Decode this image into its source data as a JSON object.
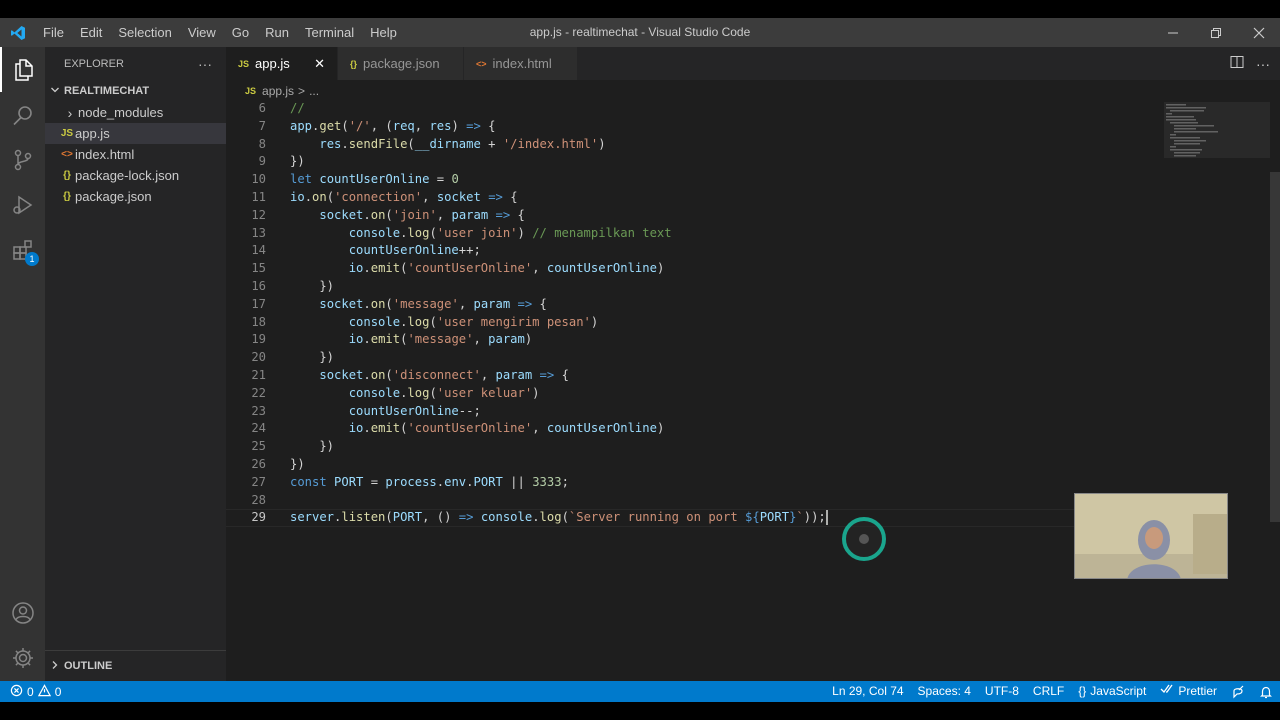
{
  "window": {
    "title": "app.js - realtimechat - Visual Studio Code"
  },
  "menu": [
    "File",
    "Edit",
    "Selection",
    "View",
    "Go",
    "Run",
    "Terminal",
    "Help"
  ],
  "activitybar": {
    "extensions_badge": "1"
  },
  "sidebar": {
    "header": "EXPLORER",
    "more": "···",
    "folder": "REALTIMECHAT",
    "items": [
      {
        "icon": "›",
        "label": "node_modules"
      },
      {
        "icon": "JS",
        "label": "app.js"
      },
      {
        "icon": "<>",
        "label": "index.html"
      },
      {
        "icon": "{}",
        "label": "package-lock.json"
      },
      {
        "icon": "{}",
        "label": "package.json"
      }
    ],
    "outline": "OUTLINE"
  },
  "tabs": [
    {
      "icon": "JS",
      "label": "app.js",
      "close": "✕"
    },
    {
      "icon": "{}",
      "label": "package.json"
    },
    {
      "icon": "<>",
      "label": "index.html"
    }
  ],
  "breadcrumb": {
    "icon": "JS",
    "file": "app.js",
    "sep": ">",
    "rest": "..."
  },
  "code": {
    "line_numbers": [
      "6",
      "7",
      "8",
      "9",
      "10",
      "11",
      "12",
      "13",
      "14",
      "15",
      "16",
      "17",
      "18",
      "19",
      "20",
      "21",
      "22",
      "23",
      "24",
      "25",
      "26",
      "27",
      "28",
      "29"
    ],
    "lines": [
      [
        {
          "c": "cm",
          "t": "//"
        }
      ],
      [
        {
          "c": "var",
          "t": "app"
        },
        {
          "c": "pl",
          "t": "."
        },
        {
          "c": "fn",
          "t": "get"
        },
        {
          "c": "pl",
          "t": "("
        },
        {
          "c": "str",
          "t": "'/'"
        },
        {
          "c": "pl",
          "t": ", ("
        },
        {
          "c": "var",
          "t": "req"
        },
        {
          "c": "pl",
          "t": ", "
        },
        {
          "c": "var",
          "t": "res"
        },
        {
          "c": "pl",
          "t": ") "
        },
        {
          "c": "kw",
          "t": "=>"
        },
        {
          "c": "pl",
          "t": " {"
        }
      ],
      [
        {
          "c": "pl",
          "t": "    "
        },
        {
          "c": "var",
          "t": "res"
        },
        {
          "c": "pl",
          "t": "."
        },
        {
          "c": "fn",
          "t": "sendFile"
        },
        {
          "c": "pl",
          "t": "("
        },
        {
          "c": "var",
          "t": "__dirname"
        },
        {
          "c": "pl",
          "t": " + "
        },
        {
          "c": "str",
          "t": "'/index.html'"
        },
        {
          "c": "pl",
          "t": ")"
        }
      ],
      [
        {
          "c": "pl",
          "t": "})"
        }
      ],
      [
        {
          "c": "kw",
          "t": "let"
        },
        {
          "c": "pl",
          "t": " "
        },
        {
          "c": "var",
          "t": "countUserOnline"
        },
        {
          "c": "pl",
          "t": " = "
        },
        {
          "c": "num",
          "t": "0"
        }
      ],
      [
        {
          "c": "var",
          "t": "io"
        },
        {
          "c": "pl",
          "t": "."
        },
        {
          "c": "fn",
          "t": "on"
        },
        {
          "c": "pl",
          "t": "("
        },
        {
          "c": "str",
          "t": "'connection'"
        },
        {
          "c": "pl",
          "t": ", "
        },
        {
          "c": "var",
          "t": "socket"
        },
        {
          "c": "pl",
          "t": " "
        },
        {
          "c": "kw",
          "t": "=>"
        },
        {
          "c": "pl",
          "t": " {"
        }
      ],
      [
        {
          "c": "pl",
          "t": "    "
        },
        {
          "c": "var",
          "t": "socket"
        },
        {
          "c": "pl",
          "t": "."
        },
        {
          "c": "fn",
          "t": "on"
        },
        {
          "c": "pl",
          "t": "("
        },
        {
          "c": "str",
          "t": "'join'"
        },
        {
          "c": "pl",
          "t": ", "
        },
        {
          "c": "var",
          "t": "param"
        },
        {
          "c": "pl",
          "t": " "
        },
        {
          "c": "kw",
          "t": "=>"
        },
        {
          "c": "pl",
          "t": " {"
        }
      ],
      [
        {
          "c": "pl",
          "t": "        "
        },
        {
          "c": "var",
          "t": "console"
        },
        {
          "c": "pl",
          "t": "."
        },
        {
          "c": "fn",
          "t": "log"
        },
        {
          "c": "pl",
          "t": "("
        },
        {
          "c": "str",
          "t": "'user join'"
        },
        {
          "c": "pl",
          "t": ") "
        },
        {
          "c": "cm",
          "t": "// menampilkan text"
        }
      ],
      [
        {
          "c": "pl",
          "t": "        "
        },
        {
          "c": "var",
          "t": "countUserOnline"
        },
        {
          "c": "pl",
          "t": "++;"
        }
      ],
      [
        {
          "c": "pl",
          "t": "        "
        },
        {
          "c": "var",
          "t": "io"
        },
        {
          "c": "pl",
          "t": "."
        },
        {
          "c": "fn",
          "t": "emit"
        },
        {
          "c": "pl",
          "t": "("
        },
        {
          "c": "str",
          "t": "'countUserOnline'"
        },
        {
          "c": "pl",
          "t": ", "
        },
        {
          "c": "var",
          "t": "countUserOnline"
        },
        {
          "c": "pl",
          "t": ")"
        }
      ],
      [
        {
          "c": "pl",
          "t": "    })"
        }
      ],
      [
        {
          "c": "pl",
          "t": "    "
        },
        {
          "c": "var",
          "t": "socket"
        },
        {
          "c": "pl",
          "t": "."
        },
        {
          "c": "fn",
          "t": "on"
        },
        {
          "c": "pl",
          "t": "("
        },
        {
          "c": "str",
          "t": "'message'"
        },
        {
          "c": "pl",
          "t": ", "
        },
        {
          "c": "var",
          "t": "param"
        },
        {
          "c": "pl",
          "t": " "
        },
        {
          "c": "kw",
          "t": "=>"
        },
        {
          "c": "pl",
          "t": " {"
        }
      ],
      [
        {
          "c": "pl",
          "t": "        "
        },
        {
          "c": "var",
          "t": "console"
        },
        {
          "c": "pl",
          "t": "."
        },
        {
          "c": "fn",
          "t": "log"
        },
        {
          "c": "pl",
          "t": "("
        },
        {
          "c": "str",
          "t": "'user mengirim pesan'"
        },
        {
          "c": "pl",
          "t": ")"
        }
      ],
      [
        {
          "c": "pl",
          "t": "        "
        },
        {
          "c": "var",
          "t": "io"
        },
        {
          "c": "pl",
          "t": "."
        },
        {
          "c": "fn",
          "t": "emit"
        },
        {
          "c": "pl",
          "t": "("
        },
        {
          "c": "str",
          "t": "'message'"
        },
        {
          "c": "pl",
          "t": ", "
        },
        {
          "c": "var",
          "t": "param"
        },
        {
          "c": "pl",
          "t": ")"
        }
      ],
      [
        {
          "c": "pl",
          "t": "    })"
        }
      ],
      [
        {
          "c": "pl",
          "t": "    "
        },
        {
          "c": "var",
          "t": "socket"
        },
        {
          "c": "pl",
          "t": "."
        },
        {
          "c": "fn",
          "t": "on"
        },
        {
          "c": "pl",
          "t": "("
        },
        {
          "c": "str",
          "t": "'disconnect'"
        },
        {
          "c": "pl",
          "t": ", "
        },
        {
          "c": "var",
          "t": "param"
        },
        {
          "c": "pl",
          "t": " "
        },
        {
          "c": "kw",
          "t": "=>"
        },
        {
          "c": "pl",
          "t": " {"
        }
      ],
      [
        {
          "c": "pl",
          "t": "        "
        },
        {
          "c": "var",
          "t": "console"
        },
        {
          "c": "pl",
          "t": "."
        },
        {
          "c": "fn",
          "t": "log"
        },
        {
          "c": "pl",
          "t": "("
        },
        {
          "c": "str",
          "t": "'user keluar'"
        },
        {
          "c": "pl",
          "t": ")"
        }
      ],
      [
        {
          "c": "pl",
          "t": "        "
        },
        {
          "c": "var",
          "t": "countUserOnline"
        },
        {
          "c": "pl",
          "t": "--;"
        }
      ],
      [
        {
          "c": "pl",
          "t": "        "
        },
        {
          "c": "var",
          "t": "io"
        },
        {
          "c": "pl",
          "t": "."
        },
        {
          "c": "fn",
          "t": "emit"
        },
        {
          "c": "pl",
          "t": "("
        },
        {
          "c": "str",
          "t": "'countUserOnline'"
        },
        {
          "c": "pl",
          "t": ", "
        },
        {
          "c": "var",
          "t": "countUserOnline"
        },
        {
          "c": "pl",
          "t": ")"
        }
      ],
      [
        {
          "c": "pl",
          "t": "    })"
        }
      ],
      [
        {
          "c": "pl",
          "t": "})"
        }
      ],
      [
        {
          "c": "kw",
          "t": "const"
        },
        {
          "c": "pl",
          "t": " "
        },
        {
          "c": "var",
          "t": "PORT"
        },
        {
          "c": "pl",
          "t": " = "
        },
        {
          "c": "var",
          "t": "process"
        },
        {
          "c": "pl",
          "t": "."
        },
        {
          "c": "var",
          "t": "env"
        },
        {
          "c": "pl",
          "t": "."
        },
        {
          "c": "var",
          "t": "PORT"
        },
        {
          "c": "pl",
          "t": " || "
        },
        {
          "c": "num",
          "t": "3333"
        },
        {
          "c": "pl",
          "t": ";"
        }
      ],
      [],
      [
        {
          "c": "var",
          "t": "server"
        },
        {
          "c": "pl",
          "t": "."
        },
        {
          "c": "fn",
          "t": "listen"
        },
        {
          "c": "pl",
          "t": "("
        },
        {
          "c": "var",
          "t": "PORT"
        },
        {
          "c": "pl",
          "t": ", () "
        },
        {
          "c": "kw",
          "t": "=>"
        },
        {
          "c": "pl",
          "t": " "
        },
        {
          "c": "var",
          "t": "console"
        },
        {
          "c": "pl",
          "t": "."
        },
        {
          "c": "fn",
          "t": "log"
        },
        {
          "c": "pl",
          "t": "("
        },
        {
          "c": "str",
          "t": "`Server running on port "
        },
        {
          "c": "kw",
          "t": "${"
        },
        {
          "c": "var",
          "t": "PORT"
        },
        {
          "c": "kw",
          "t": "}"
        },
        {
          "c": "str",
          "t": "`"
        },
        {
          "c": "pl",
          "t": "));"
        }
      ]
    ]
  },
  "status": {
    "errors": "0",
    "warnings": "0",
    "position": "Ln 29, Col 74",
    "spaces": "Spaces: 4",
    "encoding": "UTF-8",
    "eol": "CRLF",
    "language": "JavaScript",
    "formatter": "Prettier"
  }
}
